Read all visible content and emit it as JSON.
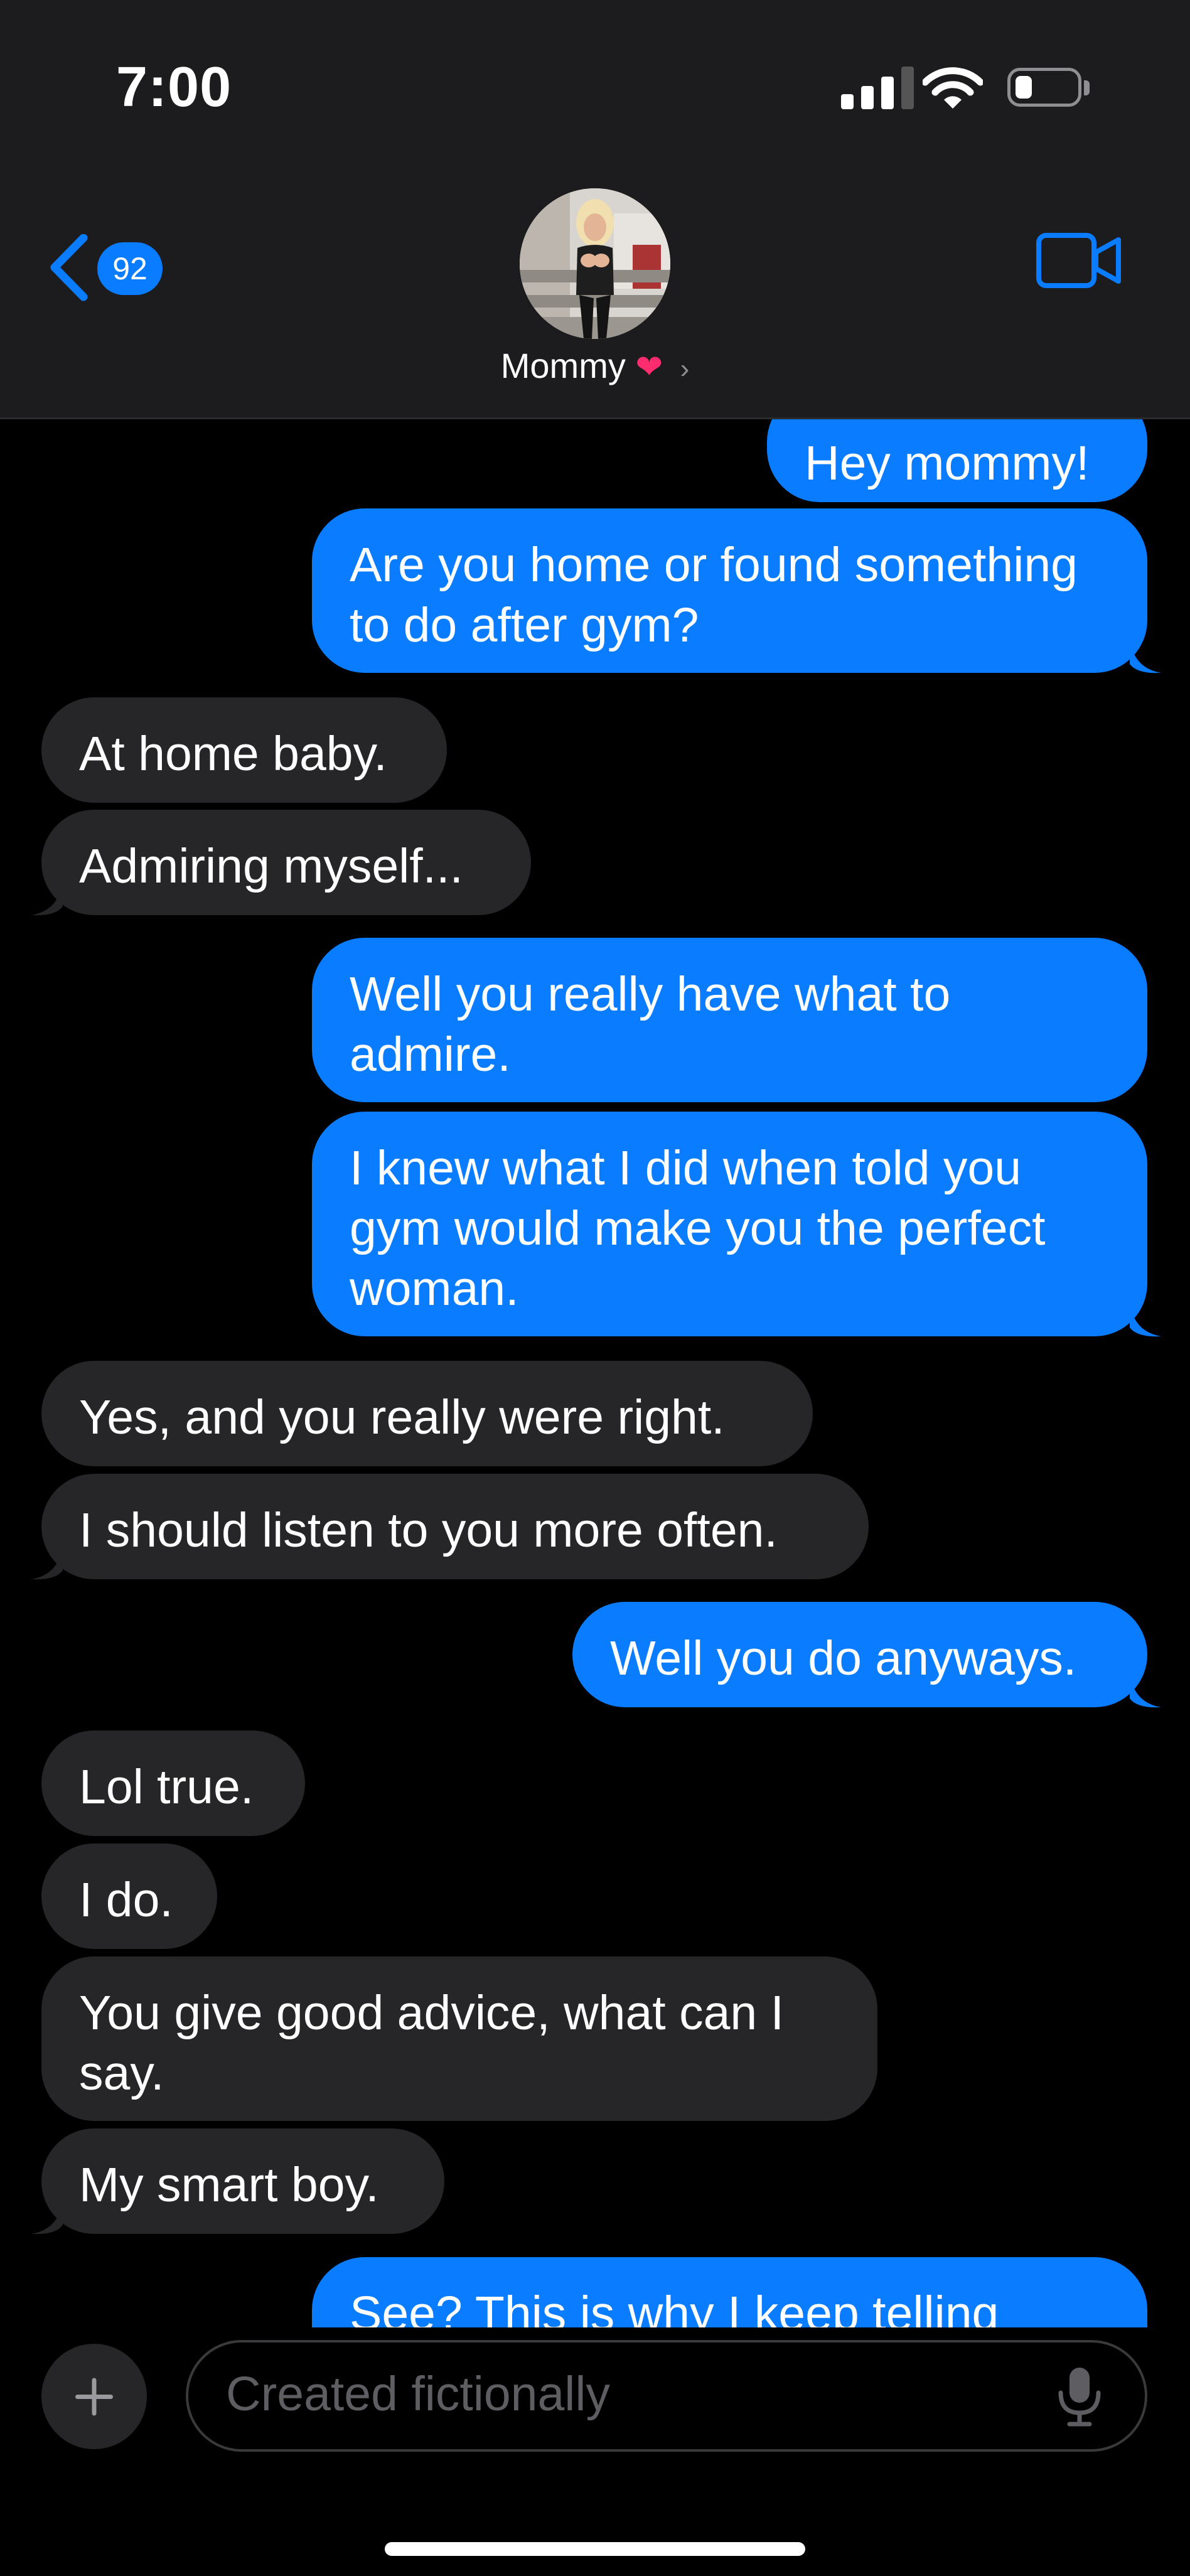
{
  "status": {
    "time": "7:00"
  },
  "nav": {
    "back_badge": "92",
    "contact_name": "Mommy",
    "contact_emoji": "❤",
    "contact_chevron": "›"
  },
  "messages": [
    {
      "from": "me",
      "text": "Hey mommy!"
    },
    {
      "from": "me",
      "text": "Are you home or found something to do after gym?"
    },
    {
      "from": "them",
      "text": "At home baby."
    },
    {
      "from": "them",
      "text": "Admiring myself..."
    },
    {
      "from": "me",
      "text": "Well you really have what to admire."
    },
    {
      "from": "me",
      "text": "I knew what I did when told you gym would make you the perfect woman."
    },
    {
      "from": "them",
      "text": "Yes, and you really were right."
    },
    {
      "from": "them",
      "text": "I should listen to you more often."
    },
    {
      "from": "me",
      "text": "Well you do anyways."
    },
    {
      "from": "them",
      "text": "Lol true."
    },
    {
      "from": "them",
      "text": "I do."
    },
    {
      "from": "them",
      "text": "You give good advice, what can I say."
    },
    {
      "from": "them",
      "text": "My smart boy."
    },
    {
      "from": "me",
      "text": "See? This is why I keep telling"
    }
  ],
  "composer": {
    "placeholder": "Created fictionally"
  },
  "colors": {
    "sent": "#0a7cff",
    "received": "#262628",
    "accent": "#0a7cff",
    "bar": "#1c1c1e"
  },
  "icons": [
    "back-chevron-icon",
    "video-camera-icon",
    "plus-icon",
    "microphone-icon",
    "wifi-icon",
    "signal-icon",
    "battery-icon"
  ]
}
